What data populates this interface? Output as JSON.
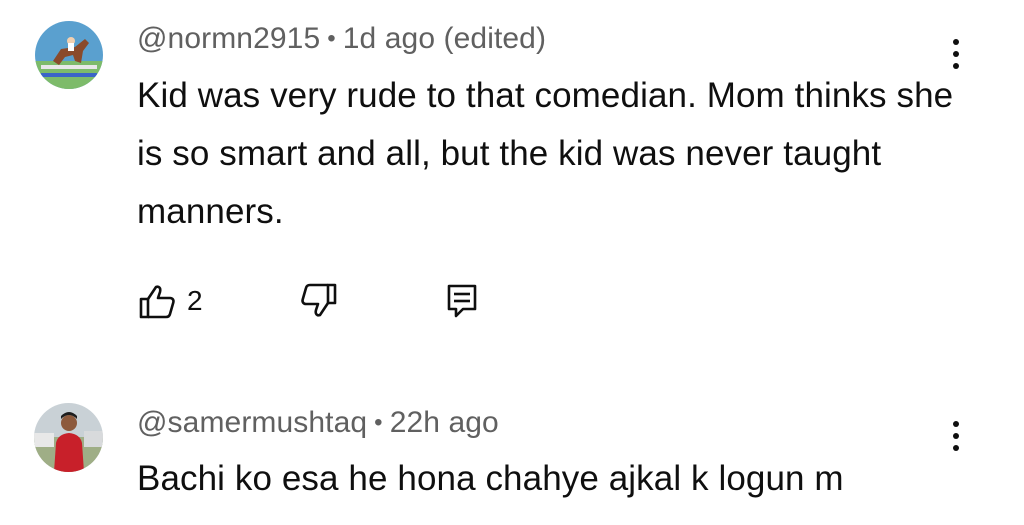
{
  "comments": [
    {
      "handle": "@normn2915",
      "separator": "•",
      "time": "1d ago (edited)",
      "text": "Kid was very rude to that comedian. Mom thinks she is so smart and all, but the kid was never taught manners.",
      "like_count": "2",
      "avatar_icon": "horse-jump-avatar",
      "more_icon": "more-vertical-icon"
    },
    {
      "handle": "@samermushtaq",
      "separator": "•",
      "time": "22h ago",
      "text": "Bachi ko esa he hona chahye ajkal k logun m",
      "avatar_icon": "person-photo-avatar",
      "more_icon": "more-vertical-icon"
    }
  ],
  "icons": {
    "like": "thumbs-up-icon",
    "dislike": "thumbs-down-icon",
    "reply": "reply-icon"
  },
  "colors": {
    "text": "#0f0f0f",
    "meta": "#606060",
    "background": "#ffffff"
  }
}
